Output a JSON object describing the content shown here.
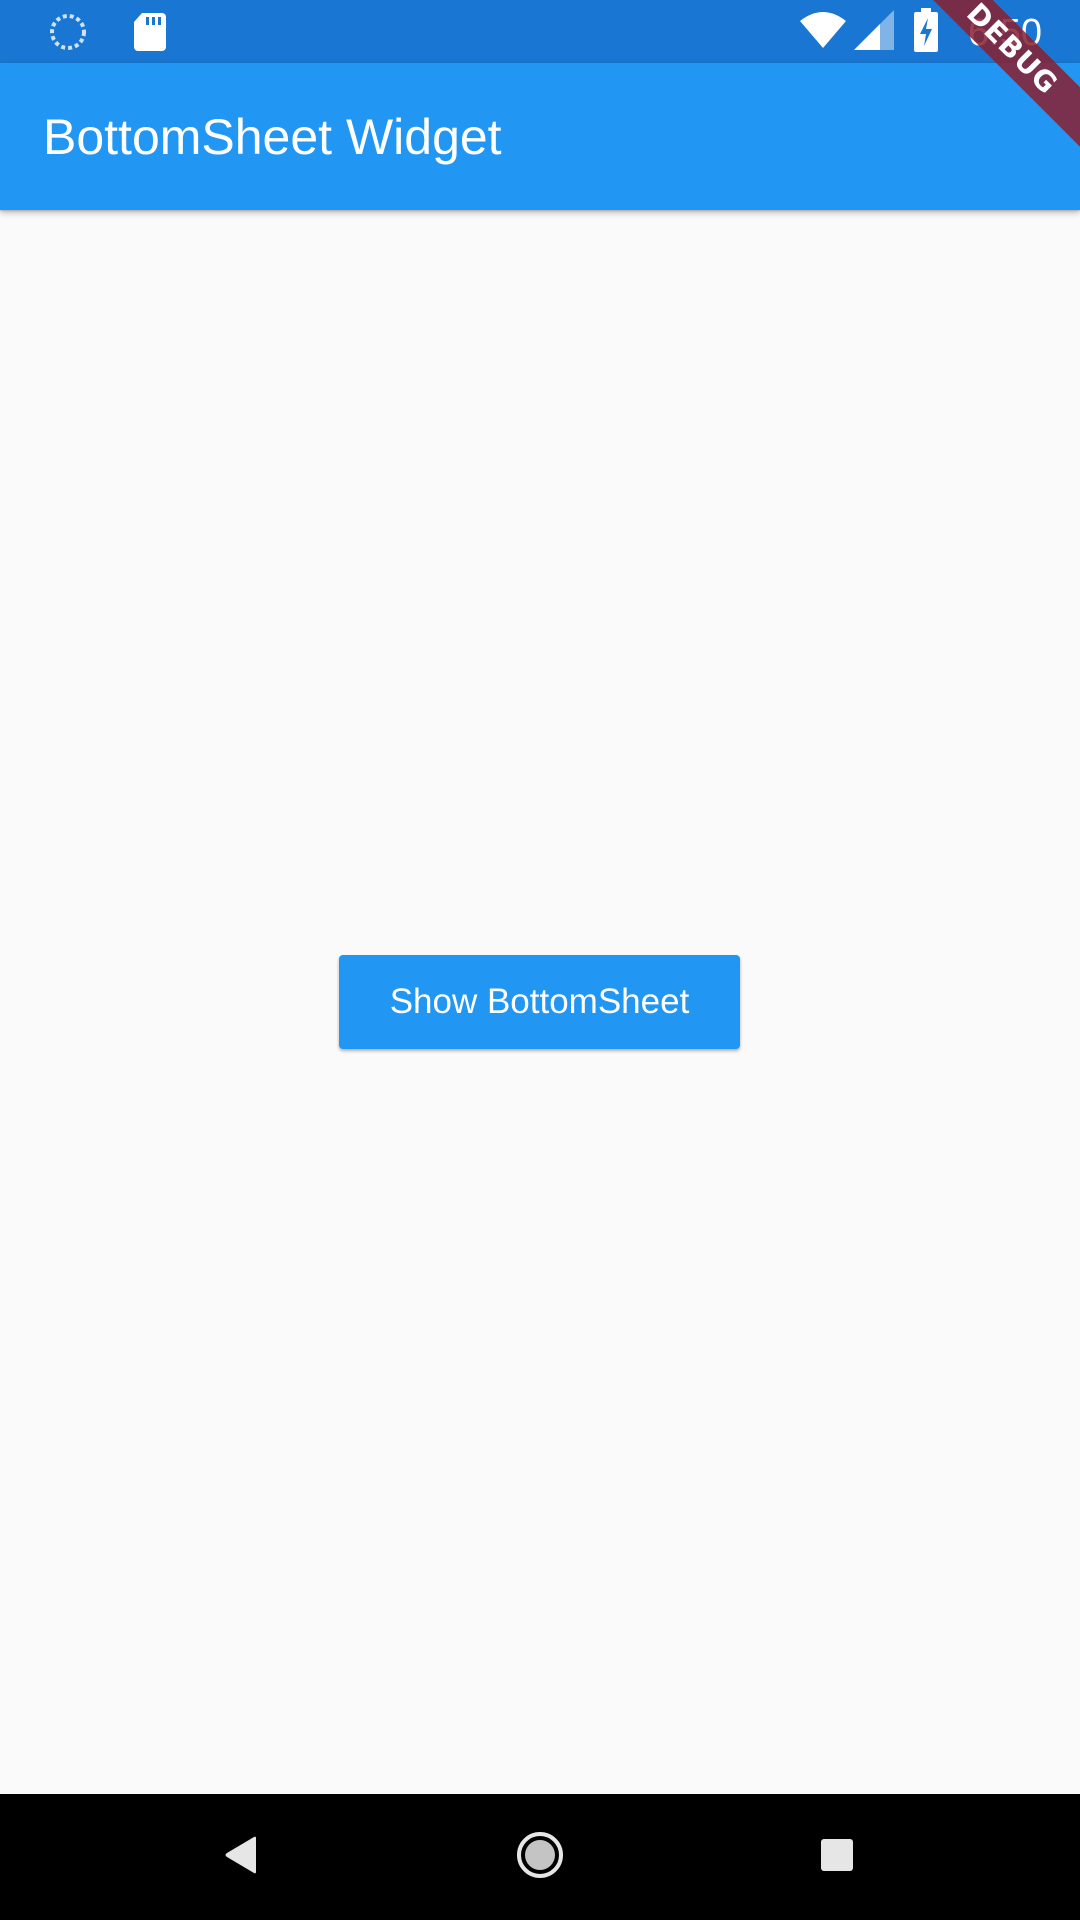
{
  "status_bar": {
    "time": "6:50",
    "icons": [
      "loading-icon",
      "sd-card-icon",
      "wifi-icon",
      "signal-icon",
      "battery-charging-icon"
    ]
  },
  "app_bar": {
    "title": "BottomSheet Widget"
  },
  "debug_banner": {
    "label": "DEBUG"
  },
  "main": {
    "button_label": "Show BottomSheet"
  },
  "nav_bar": {
    "icons": [
      "back-icon",
      "home-icon",
      "recents-icon"
    ]
  },
  "colors": {
    "status_bar": "#1976d2",
    "app_bar": "#2196f3",
    "button": "#2196f3",
    "background": "#fafafa",
    "debug_banner": "#882030"
  }
}
